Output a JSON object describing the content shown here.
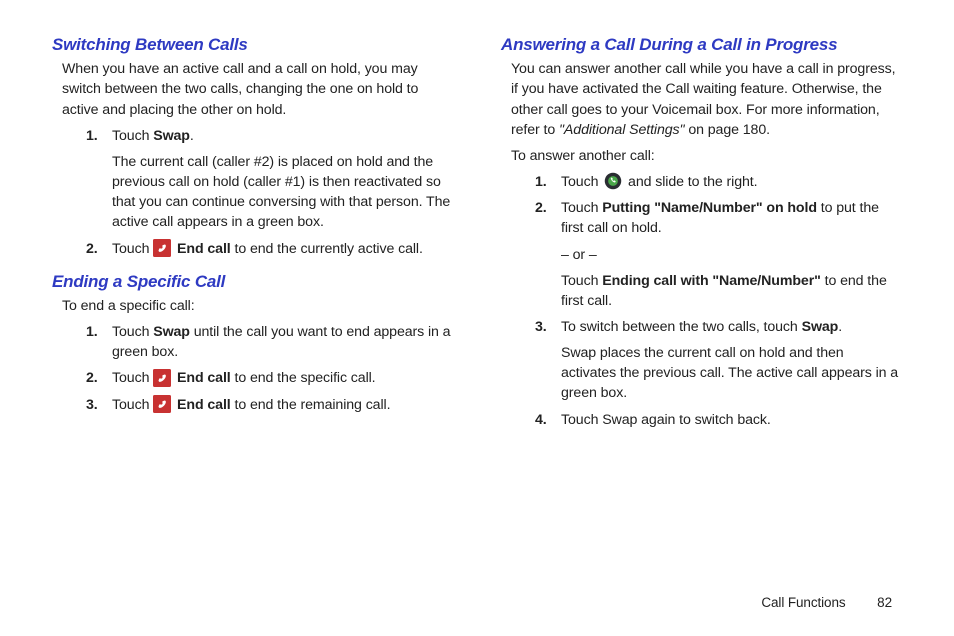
{
  "col1": {
    "section1": {
      "heading": "Switching Between Calls",
      "intro": "When you have an active call and a call on hold, you may switch between the two calls, changing the one on hold to active and placing the other on hold.",
      "step1_pre": "Touch ",
      "step1_bold": "Swap",
      "step1_post": ".",
      "step1_sub": "The current call (caller #2) is placed on hold and the previous call on hold (caller #1) is then reactivated so that you can continue conversing with that person. The active call appears in a green box.",
      "step2_pre": "Touch ",
      "step2_bold": " End call",
      "step2_post": " to end the currently active call."
    },
    "section2": {
      "heading": "Ending a Specific Call",
      "intro": "To end a specific call:",
      "step1_pre": "Touch ",
      "step1_bold": "Swap",
      "step1_post": " until the call you want to end appears in a green box.",
      "step2_pre": "Touch ",
      "step2_bold": " End call",
      "step2_post": " to end the specific call.",
      "step3_pre": "Touch ",
      "step3_bold": " End call",
      "step3_post": " to end the remaining call."
    }
  },
  "col2": {
    "section1": {
      "heading": "Answering a Call During a Call in Progress",
      "intro_pre": "You can answer another call while you have a call in progress, if you have activated the Call waiting feature. Otherwise, the other call goes to your Voicemail box. For more information, refer to ",
      "intro_xref": "\"Additional Settings\"",
      "intro_post": "  on page 180.",
      "lead": "To answer another call:",
      "step1_pre": "Touch ",
      "step1_post": " and slide to the right.",
      "step2_pre": "Touch ",
      "step2_bold": "Putting \"Name/Number\" on hold",
      "step2_post": " to put the first call on hold.",
      "step2_or": "– or –",
      "step2b_pre": "Touch ",
      "step2b_bold": "Ending call with \"Name/Number\"",
      "step2b_post": " to end the first call.",
      "step3_pre": "To switch between the two calls, touch ",
      "step3_bold": "Swap",
      "step3_post": ".",
      "step3_sub": "Swap places the current call on hold and then activates the previous call. The active call appears in a green box.",
      "step4": "Touch Swap again to switch back."
    }
  },
  "footer": {
    "section": "Call Functions",
    "page": "82"
  }
}
